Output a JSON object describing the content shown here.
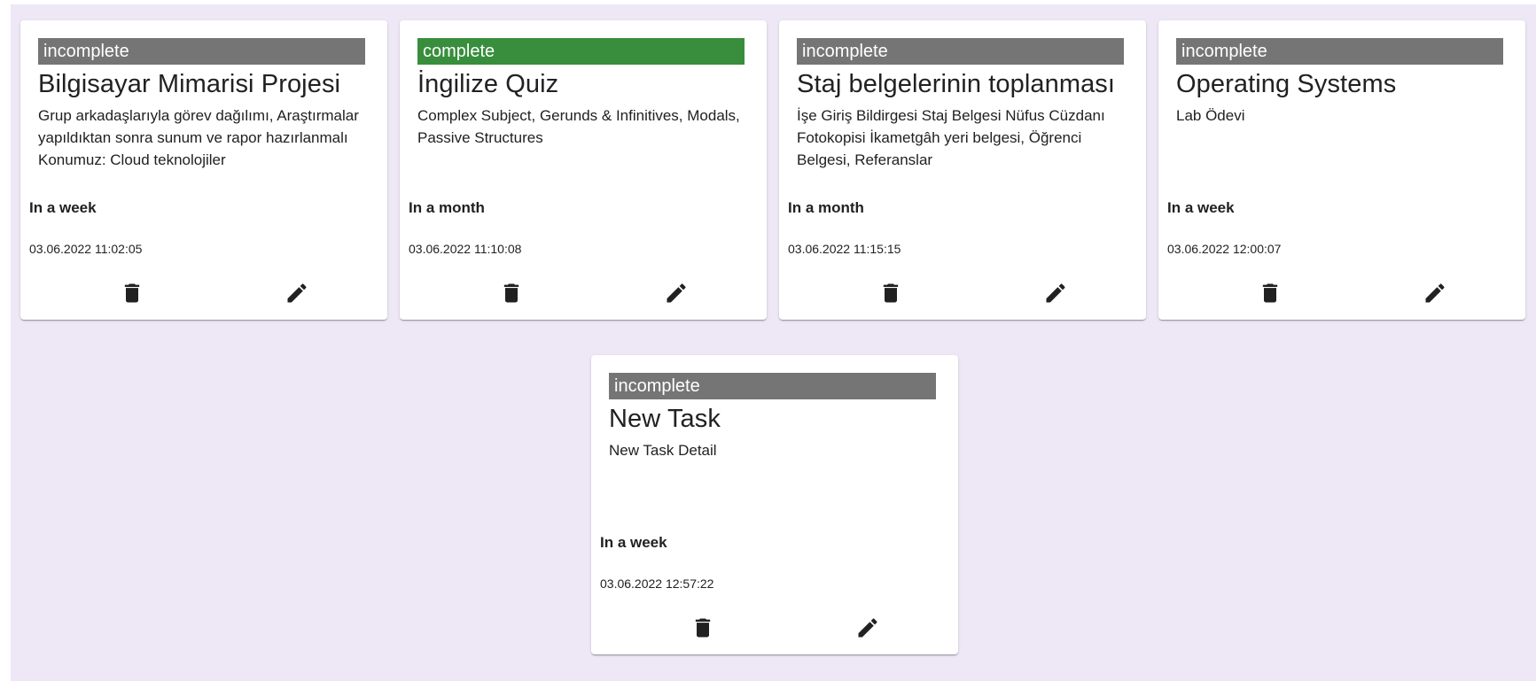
{
  "tasks": [
    {
      "status": "incomplete",
      "title": "Bilgisayar Mimarisi Projesi",
      "detail": "Grup arkadaşlarıyla görev dağılımı, Araştırmalar yapıldıktan sonra sunum ve rapor hazırlanmalı Konumuz: Cloud teknolojiler",
      "due": "In a week",
      "created": "03.06.2022 11:02:05"
    },
    {
      "status": "complete",
      "title": "İngilize Quiz",
      "detail": "Complex Subject, Gerunds & Infinitives, Modals, Passive Structures",
      "due": "In a month",
      "created": "03.06.2022 11:10:08"
    },
    {
      "status": "incomplete",
      "title": "Staj belgelerinin toplanması",
      "detail": "İşe Giriş Bildirgesi Staj Belgesi Nüfus Cüzdanı Fotokopisi İkametgâh yeri belgesi, Öğrenci Belgesi, Referanslar",
      "due": "In a month",
      "created": "03.06.2022 11:15:15"
    },
    {
      "status": "incomplete",
      "title": "Operating Systems",
      "detail": "Lab Ödevi",
      "due": "In a week",
      "created": "03.06.2022 12:00:07"
    },
    {
      "status": "incomplete",
      "title": "New Task",
      "detail": "New Task Detail",
      "due": "In a week",
      "created": "03.06.2022 12:57:22"
    }
  ],
  "icons": {
    "delete": "trash-icon",
    "edit": "pencil-icon"
  },
  "colors": {
    "background": "#ede7f6",
    "incomplete": "#757575",
    "complete": "#388e3c"
  }
}
